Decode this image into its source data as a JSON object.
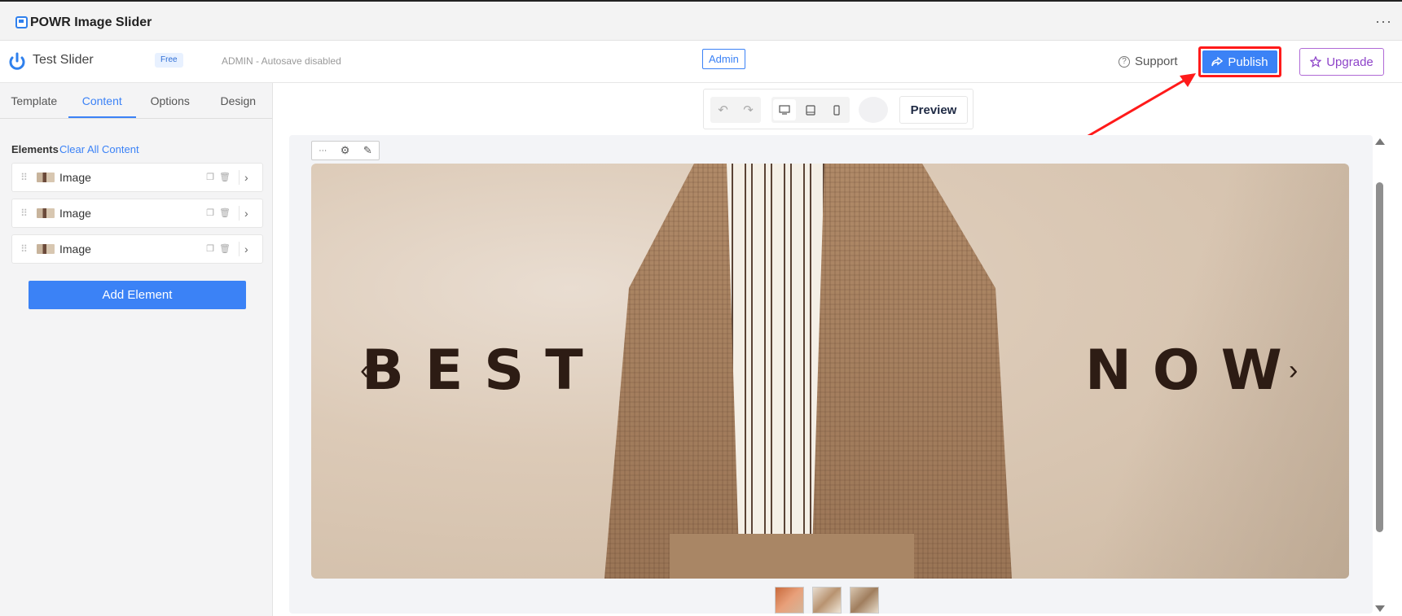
{
  "app": {
    "title": "POWR Image Slider",
    "menu": "···"
  },
  "header": {
    "widget_name": "Test Slider",
    "plan_badge": "Free",
    "admin_status": "ADMIN - Autosave disabled",
    "admin_chip": "Admin",
    "support_label": "Support",
    "publish_label": "Publish",
    "upgrade_label": "Upgrade"
  },
  "sidebar": {
    "tabs": [
      {
        "label": "Template"
      },
      {
        "label": "Content"
      },
      {
        "label": "Options"
      },
      {
        "label": "Design"
      }
    ],
    "active_tab": "Content",
    "elements_heading": "Elements",
    "clear_all": "Clear All Content",
    "elements": [
      {
        "label": "Image"
      },
      {
        "label": "Image"
      },
      {
        "label": "Image"
      }
    ],
    "add_element": "Add Element"
  },
  "toolbar": {
    "preview_label": "Preview"
  },
  "slide": {
    "left_word": "BEST",
    "right_word": "NOW",
    "prev_arrow": "‹",
    "next_arrow": "›"
  },
  "colors": {
    "accent": "#3b82f6",
    "annotation": "#ff1a1a",
    "upgrade": "#8e44c9"
  }
}
